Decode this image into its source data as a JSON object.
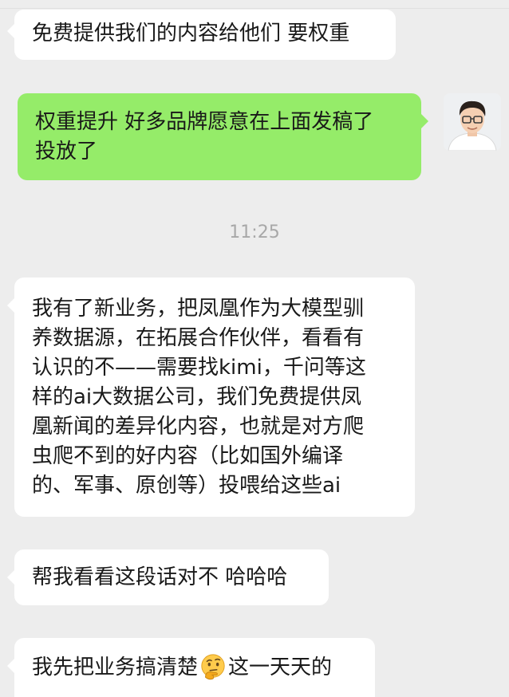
{
  "messages": [
    {
      "side": "left",
      "text": "免费提供我们的内容给他们 要权重"
    },
    {
      "side": "right",
      "line1": "权重提升 好多品牌愿意在上面发稿了",
      "line2": "投放了"
    },
    {
      "timestamp": "11:25"
    },
    {
      "side": "left",
      "lines": [
        "我有了新业务，把凤凰作为大模型驯",
        "养数据源，在拓展合作伙伴，看看有",
        "认识的不——需要找kimi，千问等这",
        "样的ai大数据公司，我们免费提供凤",
        "凰新闻的差异化内容，也就是对方爬",
        "虫爬不到的好内容（比如国外编译",
        "的、军事、原创等）投喂给这些ai"
      ]
    },
    {
      "side": "left",
      "text": "帮我看看这段话对不 哈哈哈"
    },
    {
      "side": "left",
      "before": "我先把业务搞清楚",
      "emoji": "thinking-face-emoji",
      "after": "这一天天的"
    }
  ],
  "avatar_icon": "user-avatar-icon",
  "colors": {
    "background": "#ededed",
    "incoming_bubble": "#ffffff",
    "outgoing_bubble": "#95ec69",
    "timestamp": "#a8a8a8"
  }
}
